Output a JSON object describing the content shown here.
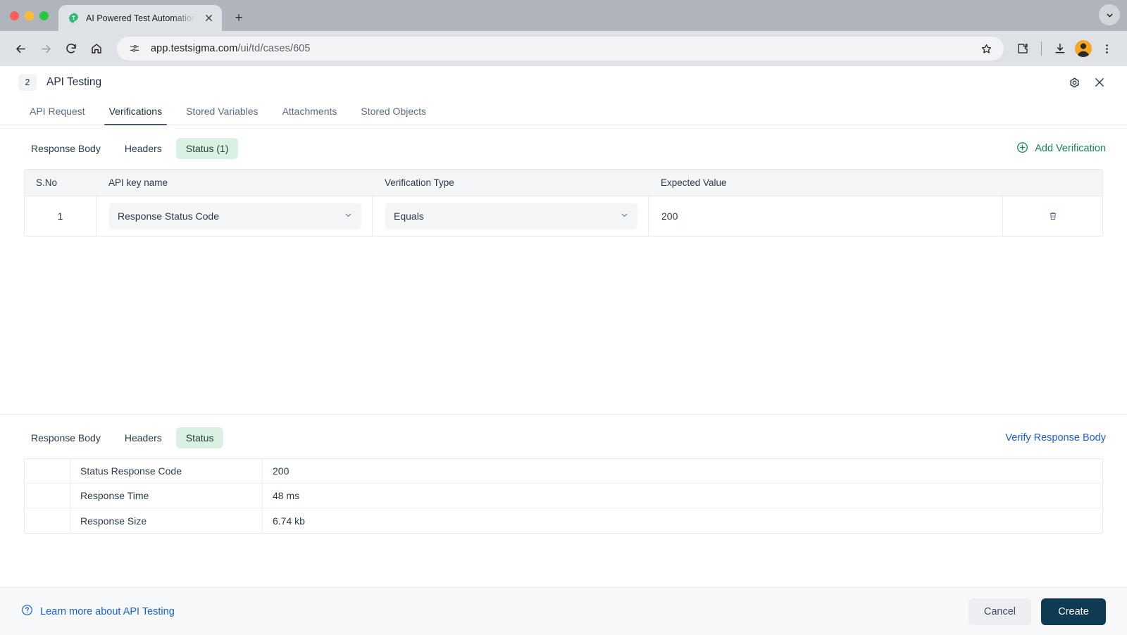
{
  "browser": {
    "tab": {
      "title": "AI Powered Test Automation P",
      "favicon": "testsigma-gear-icon",
      "close": "×"
    },
    "new_tab_label": "+",
    "collapse_icon": "chevron-down-icon",
    "toolbar": {
      "back": "back-arrow-icon",
      "forward": "forward-arrow-icon",
      "reload": "reload-icon",
      "home": "home-icon",
      "site_info": "site-settings-icon",
      "url_domain": "app.testsigma.com",
      "url_path": "/ui/td/cases/605",
      "bookmark": "star-icon",
      "extensions": "puzzle-icon",
      "downloads": "download-icon",
      "profile": "avatar-icon",
      "menu": "three-dot-menu-icon"
    }
  },
  "panel": {
    "step_number": "2",
    "title": "API Testing",
    "settings_icon": "gear-icon",
    "close_icon": "close-icon",
    "tabs": [
      {
        "label": "API Request",
        "active": false
      },
      {
        "label": "Verifications",
        "active": true
      },
      {
        "label": "Stored Variables",
        "active": false
      },
      {
        "label": "Attachments",
        "active": false
      },
      {
        "label": "Stored Objects",
        "active": false
      }
    ]
  },
  "verifications": {
    "subtabs": [
      {
        "label": "Response Body",
        "active": false
      },
      {
        "label": "Headers",
        "active": false
      },
      {
        "label": "Status (1)",
        "active": true
      }
    ],
    "add_button": {
      "label": "Add Verification",
      "icon": "plus-circle-icon",
      "color": "#17874f"
    },
    "table": {
      "headers": [
        "S.No",
        "API key name",
        "Verification Type",
        "Expected Value",
        ""
      ],
      "rows": [
        {
          "sno": "1",
          "api_key_name": "Response Status Code",
          "verification_type": "Equals",
          "expected_value": "200",
          "delete_icon": "trash-icon"
        }
      ]
    }
  },
  "response": {
    "subtabs": [
      {
        "label": "Response Body",
        "active": false
      },
      {
        "label": "Headers",
        "active": false
      },
      {
        "label": "Status",
        "active": true
      }
    ],
    "verify_link": "Verify Response Body",
    "status_rows": [
      {
        "label": "Status Response Code",
        "value": "200"
      },
      {
        "label": "Response Time",
        "value": "48 ms"
      },
      {
        "label": "Response Size",
        "value": "6.74 kb"
      }
    ]
  },
  "footer": {
    "help_icon": "question-circle-icon",
    "help_label": "Learn more about API Testing",
    "cancel_label": "Cancel",
    "create_label": "Create"
  },
  "colors": {
    "accent_green": "#17874f",
    "chip_green_bg": "#d9f0e2",
    "link_blue": "#1a5fd0",
    "primary_dark": "#0e3a52"
  }
}
